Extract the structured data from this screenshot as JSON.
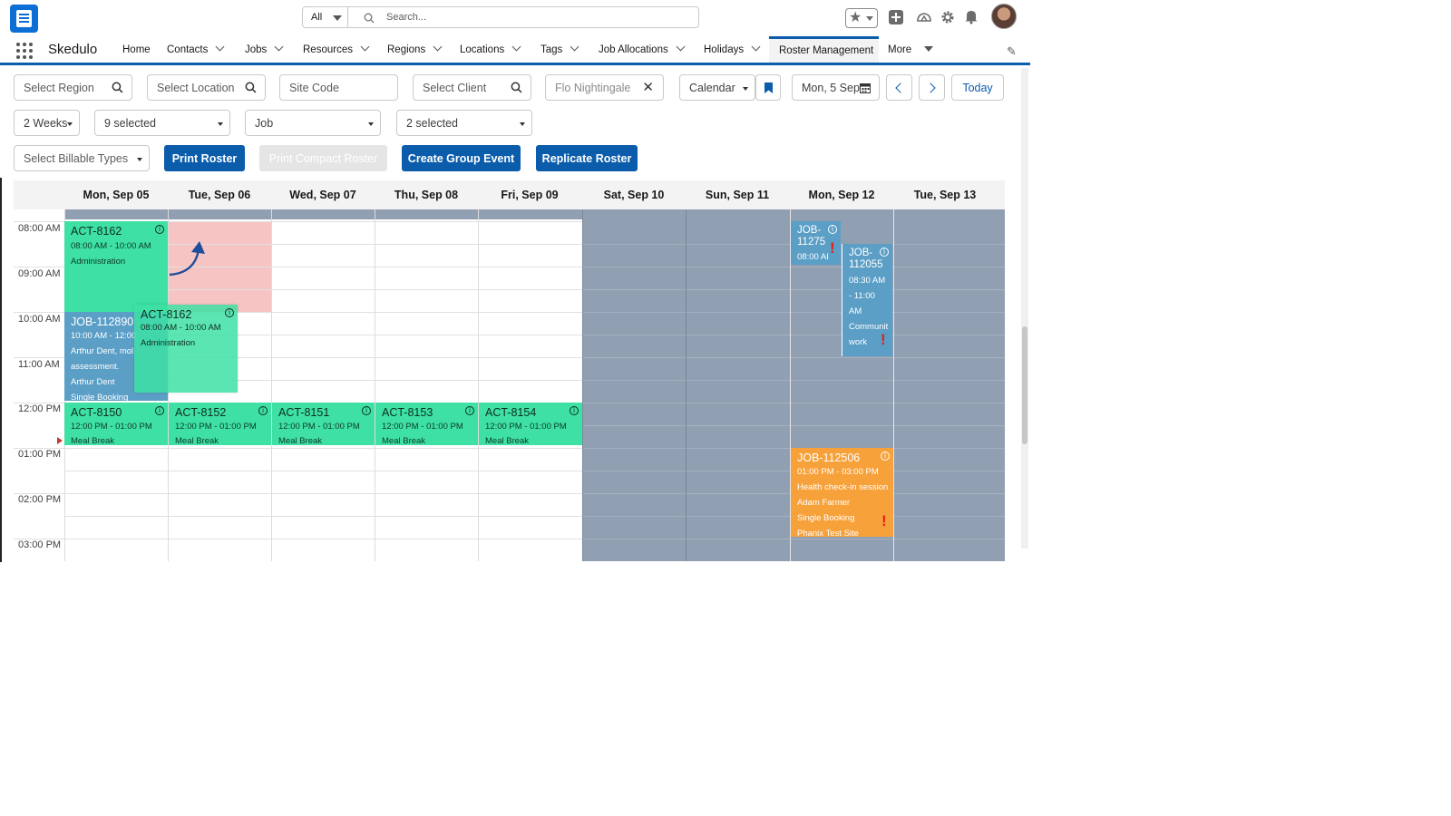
{
  "header": {
    "search_scope": "All",
    "search_placeholder": "Search..."
  },
  "nav": {
    "app_name": "Skedulo",
    "items": [
      {
        "label": "Home"
      },
      {
        "label": "Contacts"
      },
      {
        "label": "Jobs"
      },
      {
        "label": "Resources"
      },
      {
        "label": "Regions"
      },
      {
        "label": "Locations"
      },
      {
        "label": "Tags"
      },
      {
        "label": "Job Allocations"
      },
      {
        "label": "Holidays"
      },
      {
        "label": "Roster Management"
      },
      {
        "label": "More"
      }
    ]
  },
  "filters": {
    "region_placeholder": "Select Region",
    "location_placeholder": "Select Location",
    "site_code_placeholder": "Site Code",
    "client_placeholder": "Select Client",
    "resource_value": "Flo Nightingale",
    "view_select": "Calendar",
    "date_value": "Mon, 5 Sep",
    "today_label": "Today",
    "period_select": "2 Weeks",
    "multi_select_1": "9 selected",
    "type_select": "Job",
    "multi_select_2": "2 selected",
    "billable_placeholder": "Select Billable Types"
  },
  "actions": {
    "print_roster": "Print Roster",
    "print_compact_roster": "Print Compact Roster",
    "create_group_event": "Create Group Event",
    "replicate_roster": "Replicate Roster"
  },
  "calendar": {
    "days": [
      "Mon, Sep 05",
      "Tue, Sep 06",
      "Wed, Sep 07",
      "Thu, Sep 08",
      "Fri, Sep 09",
      "Sat, Sep 10",
      "Sun, Sep 11",
      "Mon, Sep 12",
      "Tue, Sep 13"
    ],
    "times": [
      "08:00 AM",
      "09:00 AM",
      "10:00 AM",
      "11:00 AM",
      "12:00 PM",
      "01:00 PM",
      "02:00 PM",
      "03:00 PM"
    ],
    "events": {
      "act8162": {
        "title": "ACT-8162",
        "time": "08:00 AM - 10:00 AM",
        "desc": "Administration"
      },
      "job112890": {
        "title": "JOB-112890",
        "time": "10:00 AM - 12:00",
        "line1": "Arthur Dent, mol",
        "line2": "assessment.",
        "line3": "Arthur Dent",
        "line4": "Single Booking"
      },
      "ghost": {
        "title": "ACT-8162",
        "time": "08:00 AM - 10:00 AM",
        "desc": "Administration"
      },
      "act8150": {
        "title": "ACT-8150",
        "time": "12:00 PM - 01:00 PM",
        "desc": "Meal Break"
      },
      "act8152": {
        "title": "ACT-8152",
        "time": "12:00 PM - 01:00 PM",
        "desc": "Meal Break"
      },
      "act8151": {
        "title": "ACT-8151",
        "time": "12:00 PM - 01:00 PM",
        "desc": "Meal Break"
      },
      "act8153": {
        "title": "ACT-8153",
        "time": "12:00 PM - 01:00 PM",
        "desc": "Meal Break"
      },
      "act8154": {
        "title": "ACT-8154",
        "time": "12:00 PM - 01:00 PM",
        "desc": "Meal Break"
      },
      "job11275": {
        "title1": "JOB-",
        "title2": "11275",
        "time": "08:00 AI"
      },
      "job112055": {
        "title1": "JOB-",
        "title2": "112055",
        "time1": "08:30 AM",
        "time2": "- 11:00",
        "time3": "AM",
        "desc1": "Communit",
        "desc2": "work"
      },
      "job112506": {
        "title": "JOB-112506",
        "time": "01:00 PM - 03:00 PM",
        "line1": "Health check-in session",
        "line2": "Adam Farmer",
        "line3": "Single Booking",
        "line4": "Phanix Test Site"
      }
    }
  },
  "colors": {
    "brand_blue": "#0b5cab",
    "activity_green": "#3ee0a4",
    "job_blue": "#5b9ec6",
    "job_orange": "#f7a13a",
    "weekend_gray": "#919fb2",
    "drop_target_pink": "#f7c4c4"
  }
}
